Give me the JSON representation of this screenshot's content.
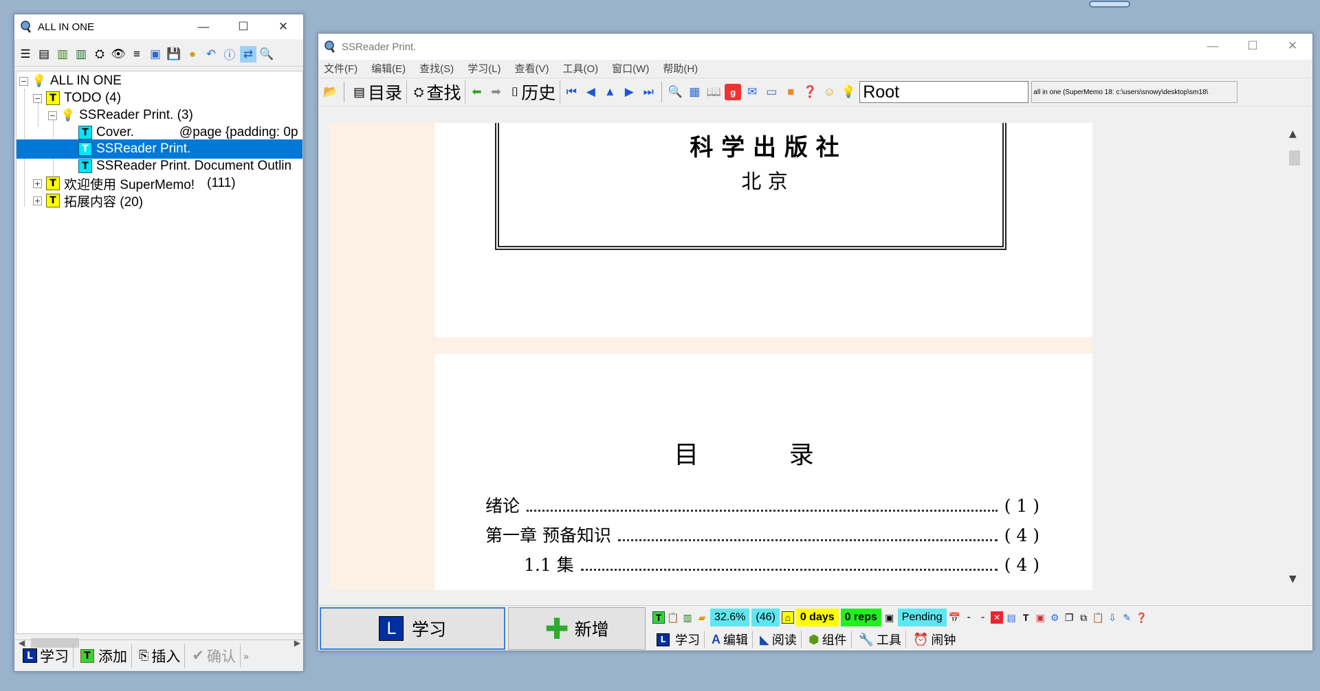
{
  "left_window": {
    "title": "ALL IN ONE",
    "tree": {
      "root": "ALL IN ONE",
      "todo": "TODO (4)",
      "ssreader_folder": "SSReader Print. (3)",
      "cover": "Cover.",
      "cover_extra": "@page {padding: 0p",
      "ssreader_print": "SSReader Print.",
      "doc_outline": "SSReader Print. Document Outlin",
      "welcome": "欢迎使用 SuperMemo!",
      "welcome_count": "(111)",
      "extend": "拓展内容 (20)"
    },
    "bottom": {
      "learn": "学习",
      "add": "添加",
      "insert": "插入",
      "confirm": "确认"
    }
  },
  "main_window": {
    "title": "SSReader Print.",
    "menu": [
      "文件(F)",
      "编辑(E)",
      "查找(S)",
      "学习(L)",
      "查看(V)",
      "工具(O)",
      "窗口(W)",
      "帮助(H)"
    ],
    "toolbar": {
      "contents": "目录",
      "find": "查找",
      "history": "历史",
      "root_value": "Root",
      "path": "all in one (SuperMemo 18: c:\\users\\snowy\\desktop\\sm18\\"
    },
    "document": {
      "publisher": "科 学 出 版 社",
      "city": "北  京",
      "toc_title": "目  录",
      "toc": [
        {
          "title": "绪论",
          "page": "( 1 )"
        },
        {
          "title": "第一章  预备知识",
          "page": "( 4 )"
        },
        {
          "title": "1.1  集",
          "page": "( 4 )"
        }
      ]
    },
    "bottom": {
      "learn_button": "学习",
      "add_button": "新增",
      "stats": {
        "pct": "32.6%",
        "count": "(46)",
        "days": "0 days",
        "reps": "0 reps",
        "pending": "Pending",
        "dash1": "-",
        "dash2": "-"
      },
      "tabs": [
        "学习",
        "编辑",
        "阅读",
        "组件",
        "工具",
        "闹钟"
      ]
    }
  },
  "colors": {
    "selection": "#0078d7",
    "topic_yellow": "#ffff00",
    "topic_cyan": "#00e6ff",
    "stat_cyan": "#5fe6f0",
    "stat_yellow": "#ffff00",
    "stat_green": "#22ee22",
    "viewer_bg": "#fdf0e4"
  }
}
